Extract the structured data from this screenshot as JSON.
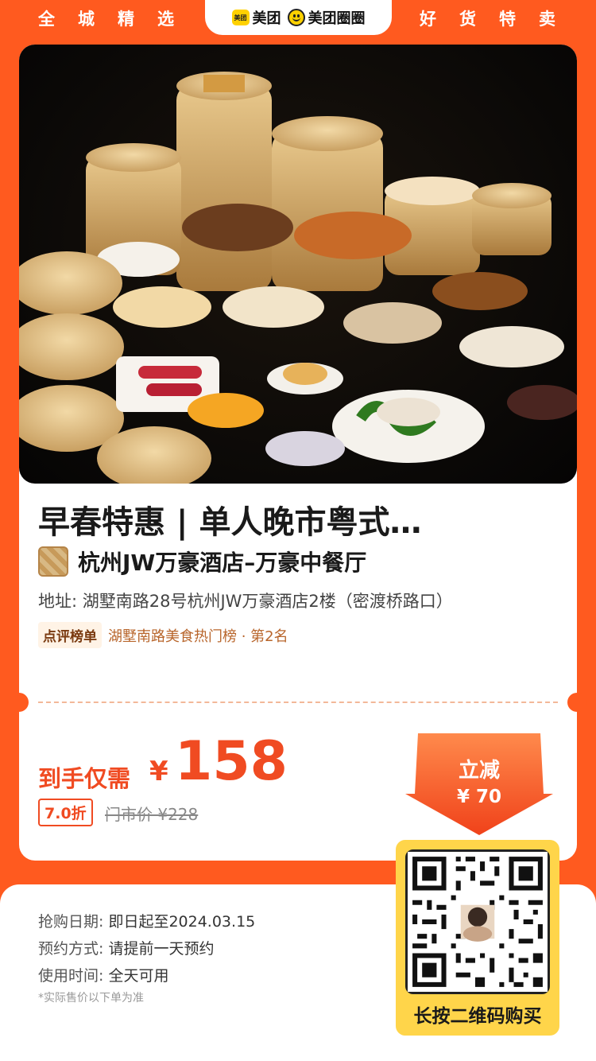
{
  "header": {
    "left_text": "全城精选",
    "right_text": "好货特卖",
    "brand_meituan": "美团",
    "brand_meituan_logo": "美团",
    "brand_quanquan": "美团圈圈"
  },
  "deal": {
    "title": "早春特惠 | 单人晚市粤式…",
    "shop_name": "杭州JW万豪酒店–万豪中餐厅",
    "address": "地址: 湖墅南路28号杭州JW万豪酒店2楼（密渡桥路口）",
    "rank_badge": "点评榜单",
    "rank_text": "湖墅南路美食热门榜 · 第2名"
  },
  "price": {
    "label": "到手仅需",
    "currency": "¥",
    "value": "158",
    "discount": "7.0折",
    "original": "门市价 ¥228",
    "reduction_title": "立减",
    "reduction_value": "¥ 70"
  },
  "info": {
    "purchase_date_key": "抢购日期:",
    "purchase_date_val": "即日起至2024.03.15",
    "booking_key": "预约方式:",
    "booking_val": "请提前一天预约",
    "usage_key": "使用时间:",
    "usage_val": "全天可用",
    "note": "*实际售价以下单为准"
  },
  "qr": {
    "label": "长按二维码购买"
  },
  "colors": {
    "brand_orange": "#ff5a1f",
    "price_red": "#f04b22",
    "qr_yellow": "#ffd54a"
  }
}
